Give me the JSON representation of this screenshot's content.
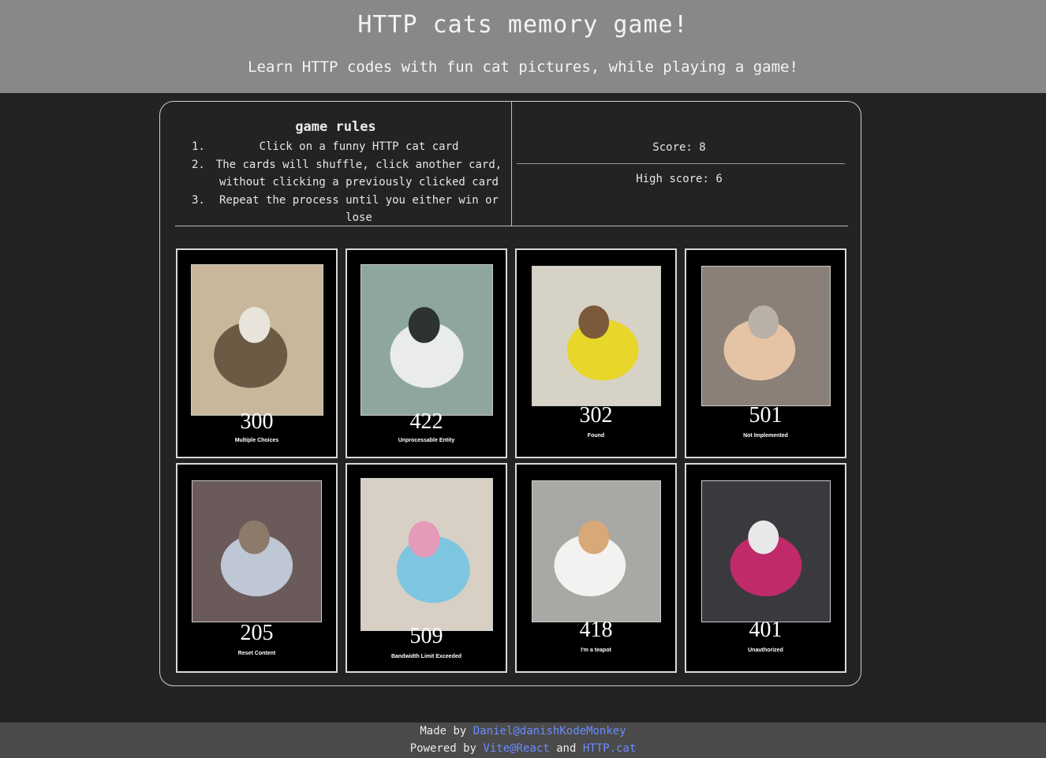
{
  "header": {
    "title": "HTTP cats memory game!",
    "subtitle": "Learn HTTP codes with fun cat pictures, while playing a game!"
  },
  "rules": {
    "heading": "game rules",
    "items": [
      {
        "num": "1.",
        "text": "Click on a funny HTTP cat card"
      },
      {
        "num": "2.",
        "text": "The cards will shuffle, click another card, without clicking a previously clicked card"
      },
      {
        "num": "3.",
        "text": "Repeat the process until you either win or lose"
      }
    ]
  },
  "score": {
    "current": "Score: 8",
    "high": "High score: 6"
  },
  "cards": [
    {
      "code": "300",
      "desc": "Multiple Choices",
      "colors": [
        "#c9b79c",
        "#6b5a44",
        "#e8e4dc"
      ]
    },
    {
      "code": "422",
      "desc": "Unprocessable Entity",
      "colors": [
        "#8fa6a0",
        "#e9ecea",
        "#2c3331"
      ]
    },
    {
      "code": "302",
      "desc": "Found",
      "colors": [
        "#d6d2c6",
        "#e8d62a",
        "#7a5a3a"
      ]
    },
    {
      "code": "501",
      "desc": "Not Implemented",
      "colors": [
        "#8a8078",
        "#e4c4a4",
        "#b9b0a8"
      ]
    },
    {
      "code": "205",
      "desc": "Reset Content",
      "colors": [
        "#6a5a5a",
        "#bfc6d4",
        "#8c7a6a"
      ]
    },
    {
      "code": "509",
      "desc": "Bandwidth Limit Exceeded",
      "colors": [
        "#d8d0c4",
        "#7ec6e0",
        "#e49ab8"
      ]
    },
    {
      "code": "418",
      "desc": "I'm a teapot",
      "colors": [
        "#a8a8a4",
        "#f2f2f0",
        "#d8a878"
      ]
    },
    {
      "code": "401",
      "desc": "Unauthorized",
      "colors": [
        "#3a3a3e",
        "#c02a6a",
        "#e8e8e8"
      ]
    }
  ],
  "footer": {
    "made_by": "Made by ",
    "author_link": "Daniel@danishKodeMonkey",
    "powered_by": "Powered by ",
    "vite_link": "Vite@React",
    "and": " and ",
    "httpcat_link": "HTTP.cat"
  }
}
